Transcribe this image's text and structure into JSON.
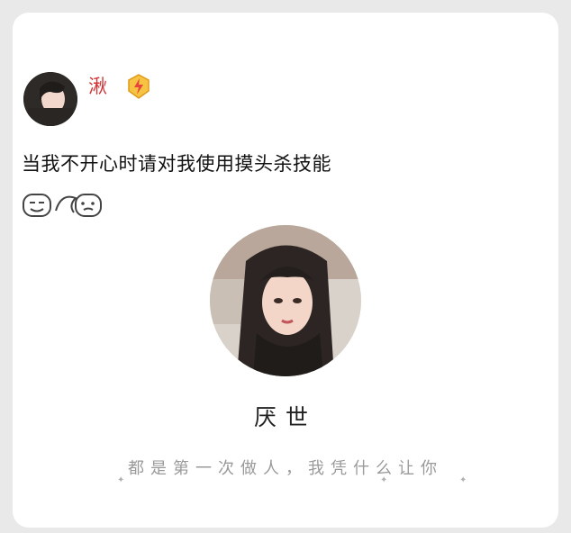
{
  "post": {
    "author": {
      "name": "湫",
      "badge_icon": "lightning-badge-icon"
    },
    "text": "当我不开心时请对我使用摸头杀技能",
    "emoji": "hand-pat-emoji"
  },
  "profile_card": {
    "name": "厌世",
    "motto": "都是第一次做人，我凭什么让你"
  }
}
